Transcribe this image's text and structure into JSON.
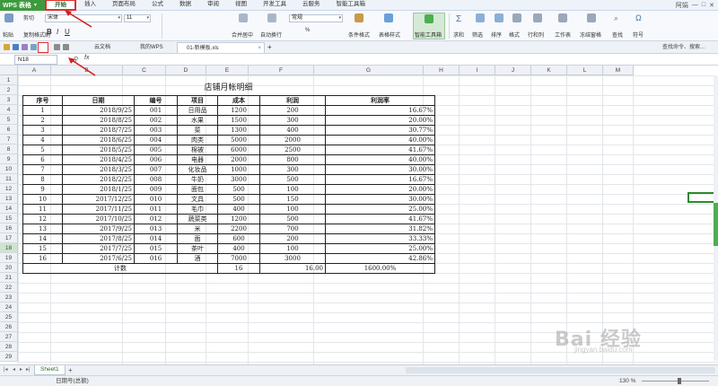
{
  "app": {
    "name": "WPS 表格"
  },
  "menu": {
    "tabs": [
      "开始",
      "插入",
      "页面布局",
      "公式",
      "数据",
      "审阅",
      "视图",
      "开发工具",
      "云服务",
      "智能工具箱"
    ],
    "active": "开始",
    "user": "阿娟"
  },
  "ribbon": {
    "paste": "粘贴",
    "cut": "剪切",
    "copy": "复制",
    "format_painter": "格式刷",
    "font_name": "宋体",
    "font_size": "11",
    "bold": "B",
    "italic": "I",
    "underline": "U",
    "merge_center": "合并居中",
    "wrap": "自动换行",
    "number_format": "常规",
    "percent": "%",
    "conditional_format": "条件格式",
    "table_style": "表格样式",
    "smart_toolbox": "智能工具箱",
    "sum": "求和",
    "filter": "筛选",
    "sort": "排序",
    "format": "格式",
    "row_col": "行和列",
    "worksheet": "工作表",
    "freeze": "冻结窗格",
    "find": "查找",
    "symbol": "符号"
  },
  "doc_tabs": [
    {
      "label": "云文档"
    },
    {
      "label": "我的WPS"
    },
    {
      "label": "01-新模板.xls"
    }
  ],
  "help_search": "查找命令、搜索...",
  "formula": {
    "cell_ref": "N18",
    "fx": "fx"
  },
  "columns": [
    "A",
    "B",
    "C",
    "D",
    "E",
    "F",
    "G",
    "H",
    "I",
    "J",
    "K",
    "L",
    "M"
  ],
  "rows": [
    "1",
    "2",
    "3",
    "4",
    "5",
    "6",
    "7",
    "8",
    "9",
    "10",
    "11",
    "12",
    "13",
    "14",
    "15",
    "16",
    "17",
    "18",
    "19",
    "20",
    "21",
    "22",
    "23",
    "24",
    "25",
    "26",
    "27",
    "28",
    "29"
  ],
  "selected": {
    "col": "N",
    "row": "18"
  },
  "sheet": {
    "title": "店铺月帐明细",
    "headers": [
      "序号",
      "日期",
      "编号",
      "项目",
      "成本",
      "利润",
      "利润率"
    ],
    "records": [
      [
        "1",
        "2018/9/25",
        "001",
        "日用品",
        "1200",
        "200",
        "16.67%"
      ],
      [
        "2",
        "2018/8/25",
        "002",
        "水果",
        "1500",
        "300",
        "20.00%"
      ],
      [
        "3",
        "2018/7/25",
        "003",
        "菜",
        "1300",
        "400",
        "30.77%"
      ],
      [
        "4",
        "2018/6/25",
        "004",
        "肉类",
        "5000",
        "2000",
        "40.00%"
      ],
      [
        "5",
        "2018/5/25",
        "005",
        "棉被",
        "6000",
        "2500",
        "41.67%"
      ],
      [
        "6",
        "2018/4/25",
        "006",
        "电器",
        "2000",
        "800",
        "40.00%"
      ],
      [
        "7",
        "2018/3/25",
        "007",
        "化妆品",
        "1000",
        "300",
        "30.00%"
      ],
      [
        "8",
        "2018/2/25",
        "008",
        "牛奶",
        "3000",
        "500",
        "16.67%"
      ],
      [
        "9",
        "2018/1/25",
        "009",
        "面包",
        "500",
        "100",
        "20.00%"
      ],
      [
        "10",
        "2017/12/25",
        "010",
        "文具",
        "500",
        "150",
        "30.00%"
      ],
      [
        "11",
        "2017/11/25",
        "011",
        "毛巾",
        "400",
        "100",
        "25.00%"
      ],
      [
        "12",
        "2017/10/25",
        "012",
        "蔬菜类",
        "1200",
        "500",
        "41.67%"
      ],
      [
        "13",
        "2017/9/25",
        "013",
        "米",
        "2200",
        "700",
        "31.82%"
      ],
      [
        "14",
        "2017/8/25",
        "014",
        "面",
        "600",
        "200",
        "33.33%"
      ],
      [
        "15",
        "2017/7/25",
        "015",
        "茶叶",
        "400",
        "100",
        "25.00%"
      ],
      [
        "16",
        "2017/6/25",
        "016",
        "酒",
        "7000",
        "3000",
        "42.86%"
      ]
    ],
    "total_label": "计数",
    "total_count": "16",
    "total_profit": "16.00",
    "total_rate": "1600.00%"
  },
  "sheet_tabs": [
    "Sheet1"
  ],
  "status": {
    "text": "日期号(总额)",
    "zoom": "130 %"
  },
  "watermark": {
    "text": "Bai 经验",
    "url": "jingyan.baidu.com"
  },
  "colors": {
    "accent": "#3d9a3d",
    "annotation": "#d02020"
  }
}
